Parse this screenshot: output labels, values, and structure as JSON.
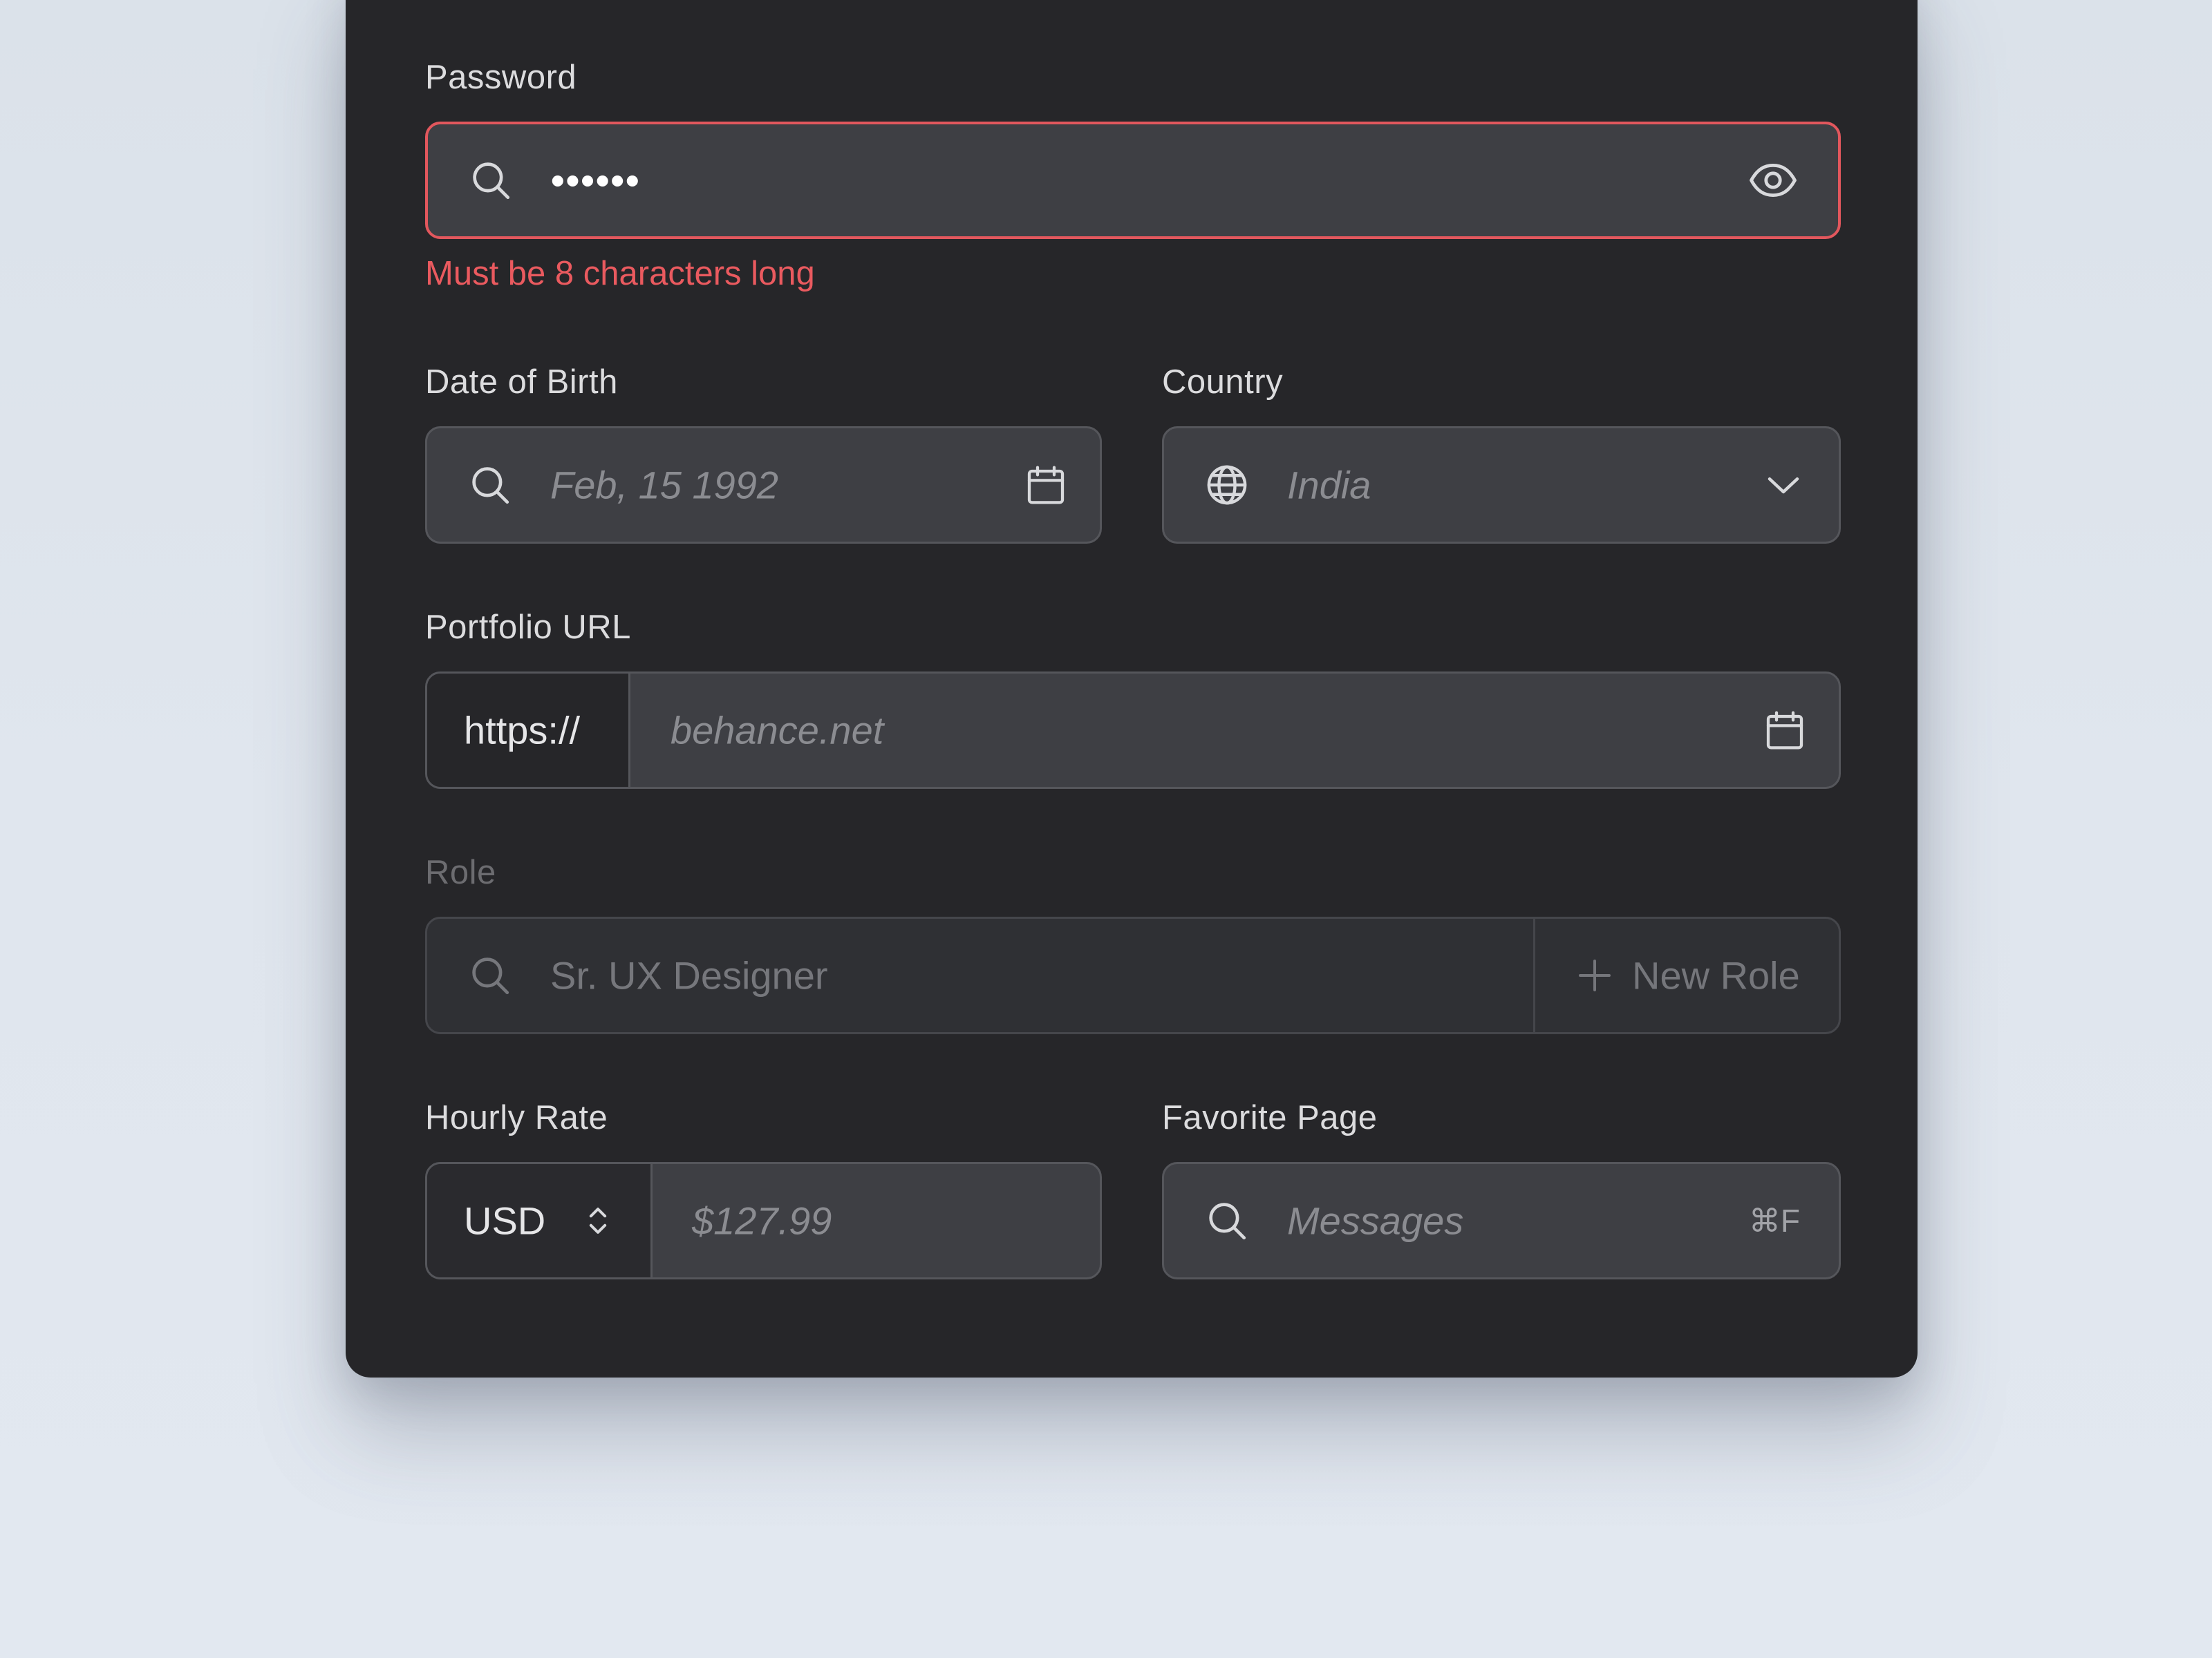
{
  "password": {
    "label": "Password",
    "value": "••••••",
    "error": "Must be 8 characters long",
    "icons": [
      "search-icon",
      "eye-icon"
    ]
  },
  "dob": {
    "label": "Date of Birth",
    "placeholder": "Feb, 15 1992",
    "icons": [
      "search-icon",
      "calendar-icon"
    ]
  },
  "country": {
    "label": "Country",
    "value": "India",
    "icons": [
      "globe-icon",
      "chevron-down-icon"
    ]
  },
  "portfolio": {
    "label": "Portfolio URL",
    "prefix": "https://",
    "placeholder": "behance.net",
    "icons": [
      "calendar-icon"
    ]
  },
  "role": {
    "label": "Role",
    "placeholder": "Sr. UX Designer",
    "add_label": "New Role",
    "icons": [
      "search-icon",
      "plus-icon"
    ]
  },
  "hourly_rate": {
    "label": "Hourly Rate",
    "currency": "USD",
    "placeholder": "$127.99",
    "icons": [
      "chevron-up-down-icon"
    ]
  },
  "favorite_page": {
    "label": "Favorite Page",
    "placeholder": "Messages",
    "shortcut": "⌘F",
    "icons": [
      "search-icon"
    ]
  },
  "colors": {
    "card": "#262629",
    "field": "#3e3f44",
    "error": "#ea5a5f",
    "background": "#dfe5ed"
  }
}
